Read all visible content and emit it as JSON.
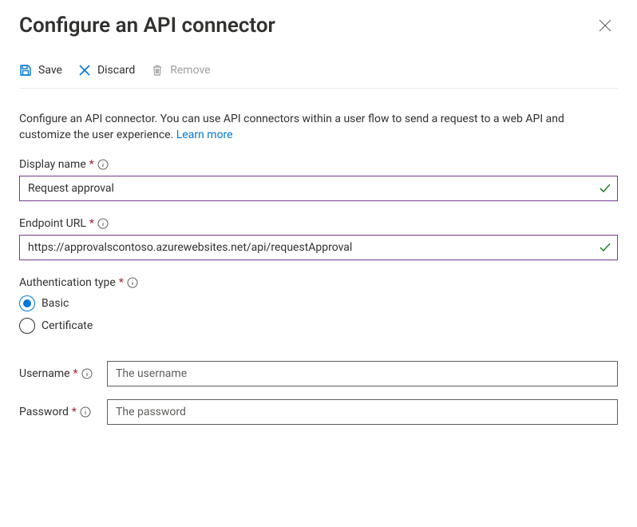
{
  "header": {
    "title": "Configure an API connector"
  },
  "toolbar": {
    "save": "Save",
    "discard": "Discard",
    "remove": "Remove"
  },
  "description": {
    "text": "Configure an API connector. You can use API connectors within a user flow to send a request to a web API and customize the user experience. ",
    "link": "Learn more"
  },
  "fields": {
    "display_name": {
      "label": "Display name",
      "value": "Request approval"
    },
    "endpoint": {
      "label": "Endpoint URL",
      "value": "https://approvalscontoso.azurewebsites.net/api/requestApproval"
    },
    "auth_type": {
      "label": "Authentication type",
      "options": {
        "basic": "Basic",
        "certificate": "Certificate"
      },
      "selected": "basic"
    },
    "username": {
      "label": "Username",
      "placeholder": "The username",
      "value": ""
    },
    "password": {
      "label": "Password",
      "placeholder": "The password",
      "value": ""
    }
  }
}
